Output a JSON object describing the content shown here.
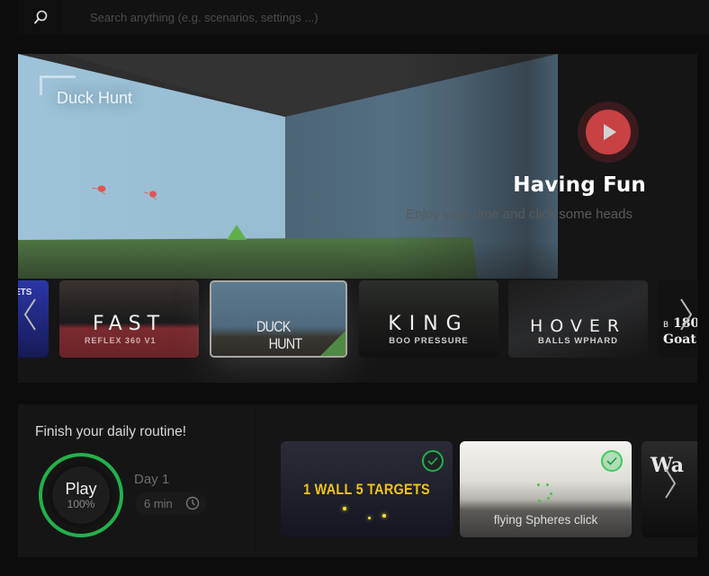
{
  "search": {
    "icon": "search-icon",
    "placeholder": "Search anything (e.g. scenarios, settings ...)",
    "value": ""
  },
  "hero": {
    "scene_title": "Duck Hunt",
    "play_icon": "play-icon",
    "heading": "Having Fun",
    "subtitle": "Enjoy your time and click some heads",
    "colors": {
      "play_button": "#c84143"
    }
  },
  "carousel": {
    "prev_icon": "chevron-left-icon",
    "next_icon": "chevron-right-icon",
    "items": [
      {
        "title": "ETS",
        "subtitle": ""
      },
      {
        "title": "FAST",
        "subtitle": "REFLEX 360 V1"
      },
      {
        "title": "DUCK",
        "title_line2": "HUNT",
        "subtitle": "",
        "selected": true
      },
      {
        "title": "KING",
        "subtitle": "BOO PRESSURE"
      },
      {
        "title": "HOVER",
        "subtitle": "BALLS WPHARD"
      },
      {
        "title_prefix": "B",
        "title": "180",
        "title_line2": "Goat",
        "subtitle": ""
      }
    ]
  },
  "routine": {
    "title": "Finish your daily routine!",
    "play_label": "Play",
    "progress_percent": "100%",
    "day_label": "Day 1",
    "duration": "6 min",
    "clock_icon": "clock-icon",
    "accent_color": "#22b14c",
    "scenarios": [
      {
        "title": "1 WALL 5 TARGETS",
        "completed": true
      },
      {
        "title": "flying Spheres click",
        "completed": true
      },
      {
        "title": "Wa",
        "completed": false
      }
    ],
    "next_icon": "chevron-right-icon"
  }
}
